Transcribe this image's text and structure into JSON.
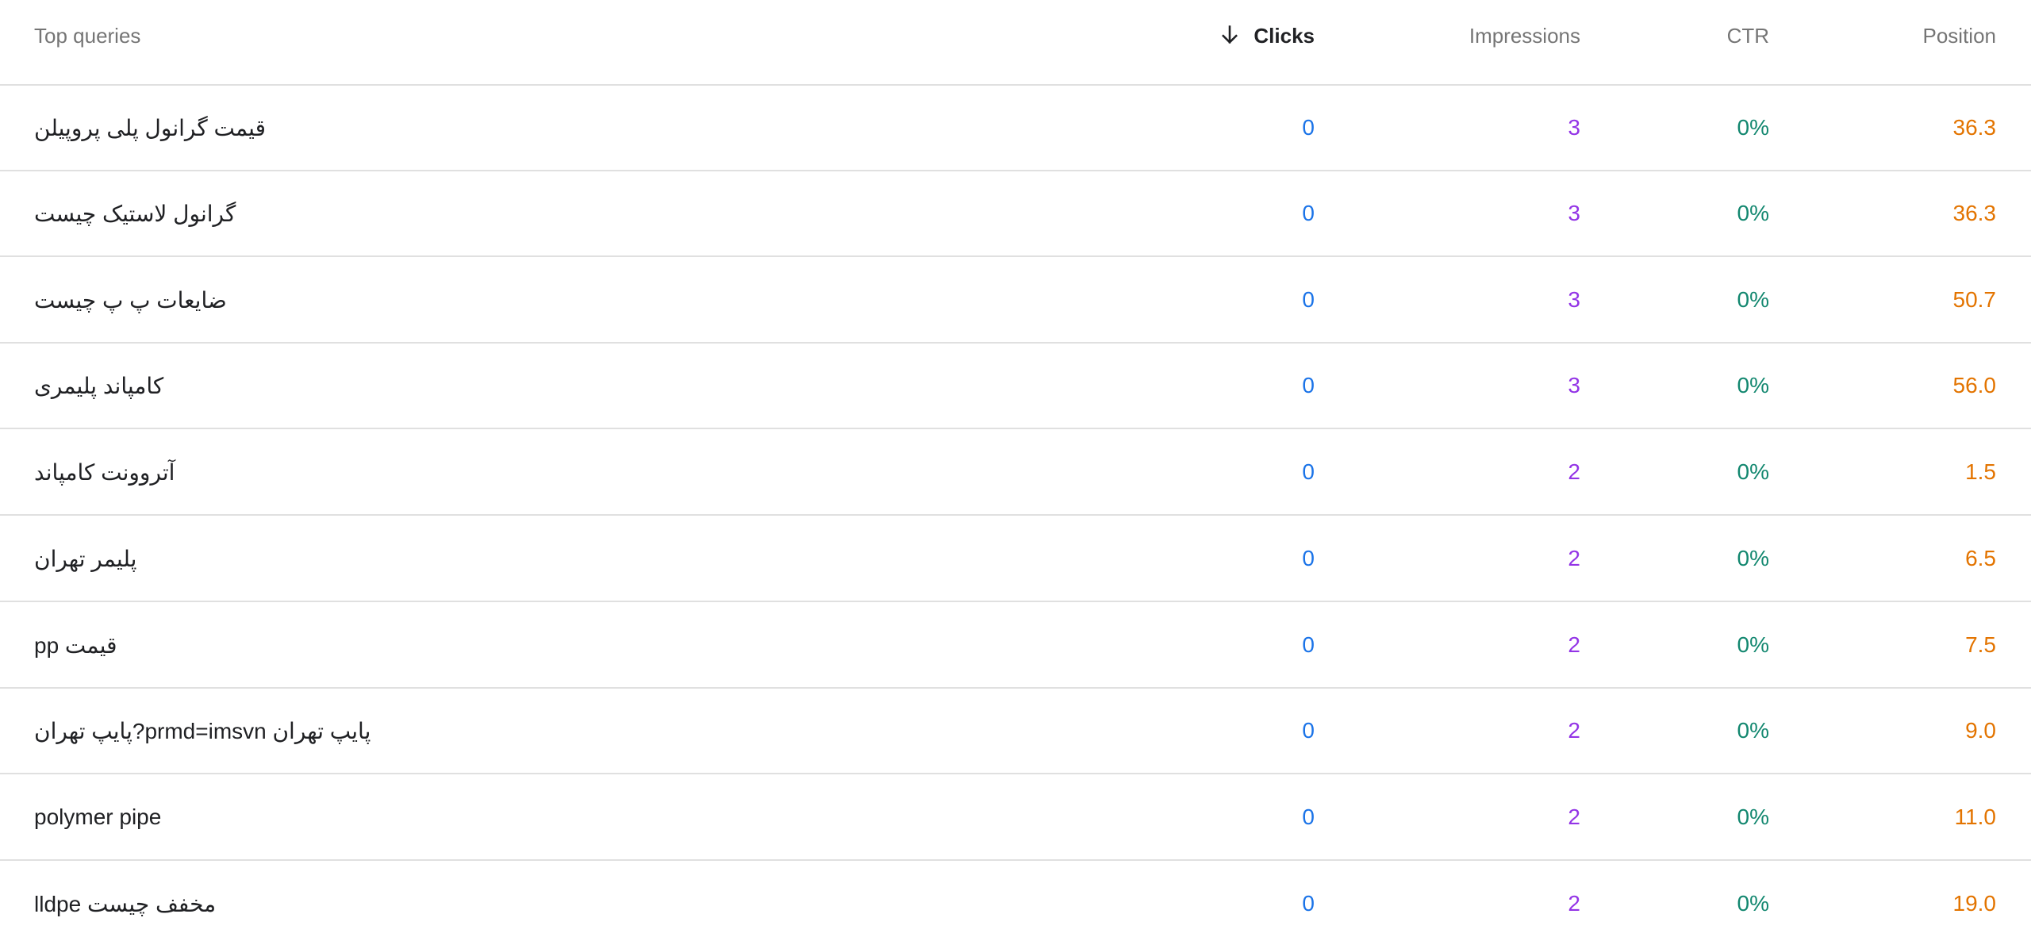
{
  "header": {
    "query_label": "Top queries",
    "clicks_label": "Clicks",
    "impressions_label": "Impressions",
    "ctr_label": "CTR",
    "position_label": "Position",
    "sort_icon": "arrow-down-icon"
  },
  "rows": [
    {
      "query": "قیمت گرانول پلی پروپیلن",
      "clicks": "0",
      "impressions": "3",
      "ctr": "0%",
      "position": "36.3"
    },
    {
      "query": "گرانول لاستیک چیست",
      "clicks": "0",
      "impressions": "3",
      "ctr": "0%",
      "position": "36.3"
    },
    {
      "query": "ضایعات پ پ چیست",
      "clicks": "0",
      "impressions": "3",
      "ctr": "0%",
      "position": "50.7"
    },
    {
      "query": "کامپاند پلیمری",
      "clicks": "0",
      "impressions": "3",
      "ctr": "0%",
      "position": "56.0"
    },
    {
      "query": "آتروونت کامپاند",
      "clicks": "0",
      "impressions": "2",
      "ctr": "0%",
      "position": "1.5"
    },
    {
      "query": "پلیمر تهران",
      "clicks": "0",
      "impressions": "2",
      "ctr": "0%",
      "position": "6.5"
    },
    {
      "query": "قیمت pp",
      "clicks": "0",
      "impressions": "2",
      "ctr": "0%",
      "position": "7.5"
    },
    {
      "query": "پایپ تهران prmd=imsvn?پایپ تهران",
      "clicks": "0",
      "impressions": "2",
      "ctr": "0%",
      "position": "9.0"
    },
    {
      "query": "polymer pipe",
      "clicks": "0",
      "impressions": "2",
      "ctr": "0%",
      "position": "11.0"
    },
    {
      "query": "lldpe مخفف چیست",
      "clicks": "0",
      "impressions": "2",
      "ctr": "0%",
      "position": "19.0"
    }
  ],
  "colors": {
    "clicks": "#1a73e8",
    "impressions": "#9334e6",
    "ctr": "#12876f",
    "position": "#e37400"
  }
}
